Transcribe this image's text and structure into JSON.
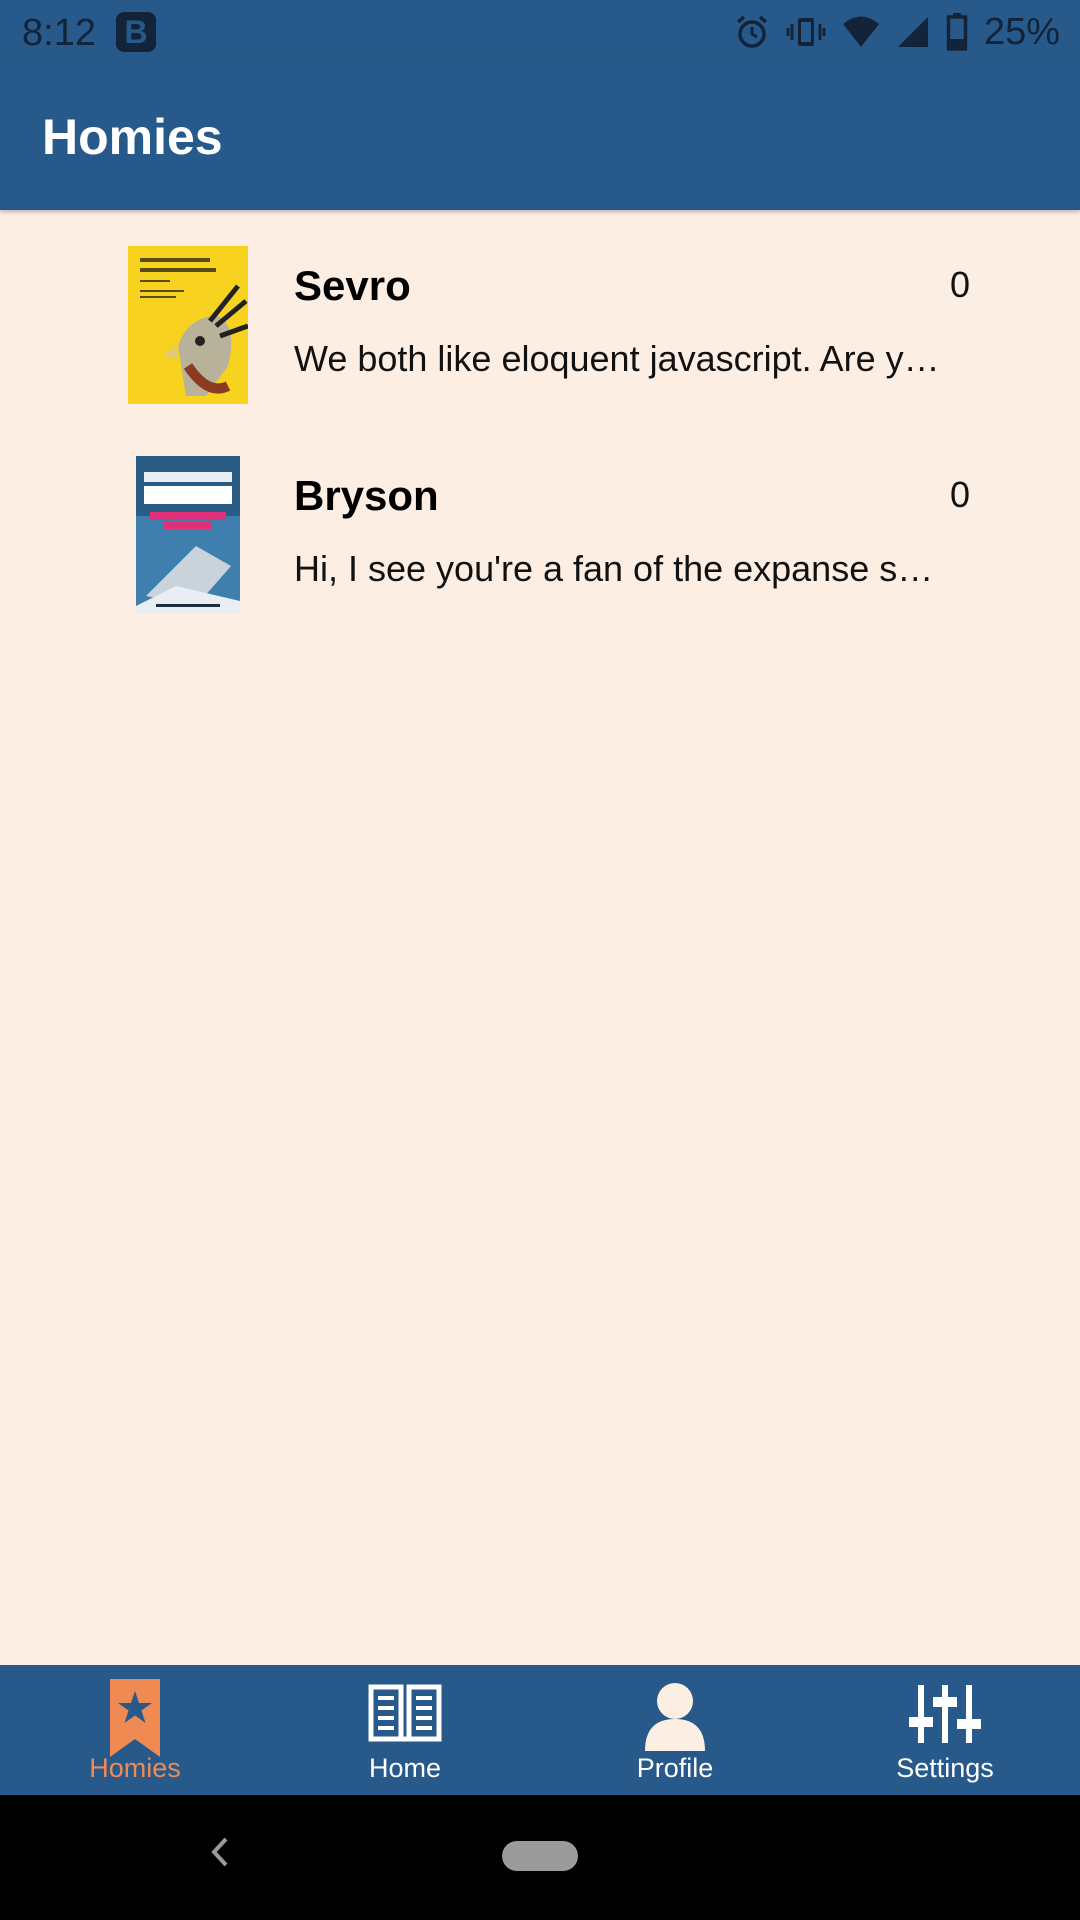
{
  "status_bar": {
    "time": "8:12",
    "notification_icon": "b-icon",
    "battery_percent": "25%",
    "icons": [
      "alarm-icon",
      "vibrate-icon",
      "wifi-icon",
      "signal-icon",
      "battery-icon"
    ]
  },
  "app_bar": {
    "title": "Homies"
  },
  "conversations": [
    {
      "name": "Sevro",
      "message": "We both like eloquent javascript. Are you reading it now?",
      "count": "0",
      "cover": "eloquent-javascript-cover"
    },
    {
      "name": "Bryson",
      "message": "Hi, I see you're a fan of the expanse series!",
      "count": "0",
      "cover": "leviathan-wakes-cover"
    }
  ],
  "bottom_nav": [
    {
      "label": "Homies",
      "icon": "bookmark-star-icon",
      "active": true
    },
    {
      "label": "Home",
      "icon": "open-book-icon",
      "active": false
    },
    {
      "label": "Profile",
      "icon": "person-icon",
      "active": false
    },
    {
      "label": "Settings",
      "icon": "sliders-icon",
      "active": false
    }
  ],
  "colors": {
    "primary": "#275a8a",
    "background": "#fdeee4",
    "accent": "#f08a53"
  }
}
